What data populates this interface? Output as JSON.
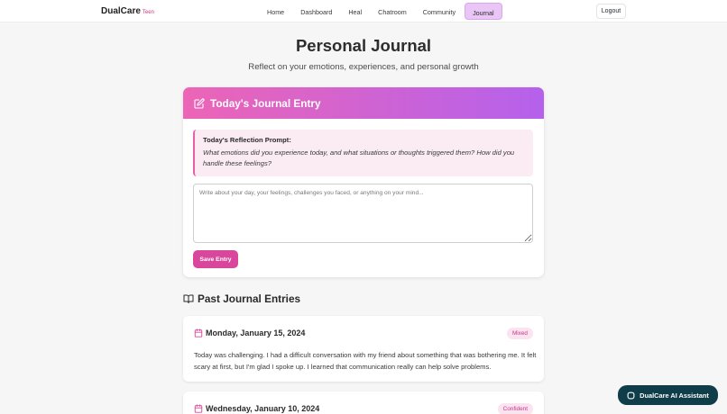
{
  "nav": {
    "brand": "DualCare",
    "brand_tag": "Teen",
    "links": [
      "Home",
      "Dashboard",
      "Heal",
      "Chatroom",
      "Community",
      "Journal"
    ],
    "active": "Journal",
    "logout": "Logout"
  },
  "page": {
    "title": "Personal Journal",
    "subtitle": "Reflect on your emotions, experiences, and personal growth"
  },
  "today": {
    "title": "Today's Journal Entry",
    "prompt_title": "Today's Reflection Prompt:",
    "prompt_text": "What emotions did you experience today, and what situations or thoughts triggered them? How did you handle these feelings?",
    "placeholder": "Write about your day, your feelings, challenges you faced, or anything on your mind...",
    "save_label": "Save Entry"
  },
  "past": {
    "title": "Past Journal Entries",
    "entries": [
      {
        "date": "Monday, January 15, 2024",
        "mood": "Mixed",
        "text": "Today was challenging. I had a difficult conversation with my friend about something that was bothering me. It felt scary at first, but I'm glad I spoke up. I learned that communication really can help solve problems."
      },
      {
        "date": "Wednesday, January 10, 2024",
        "mood": "Confident",
        "text": ""
      }
    ]
  },
  "assistant": {
    "label": "DualCare AI Assistant"
  },
  "colors": {
    "accent": "#d9479c",
    "gradient_start": "#ec65b6",
    "gradient_end": "#b561ec",
    "assistant_bg": "#0f3e4a"
  }
}
